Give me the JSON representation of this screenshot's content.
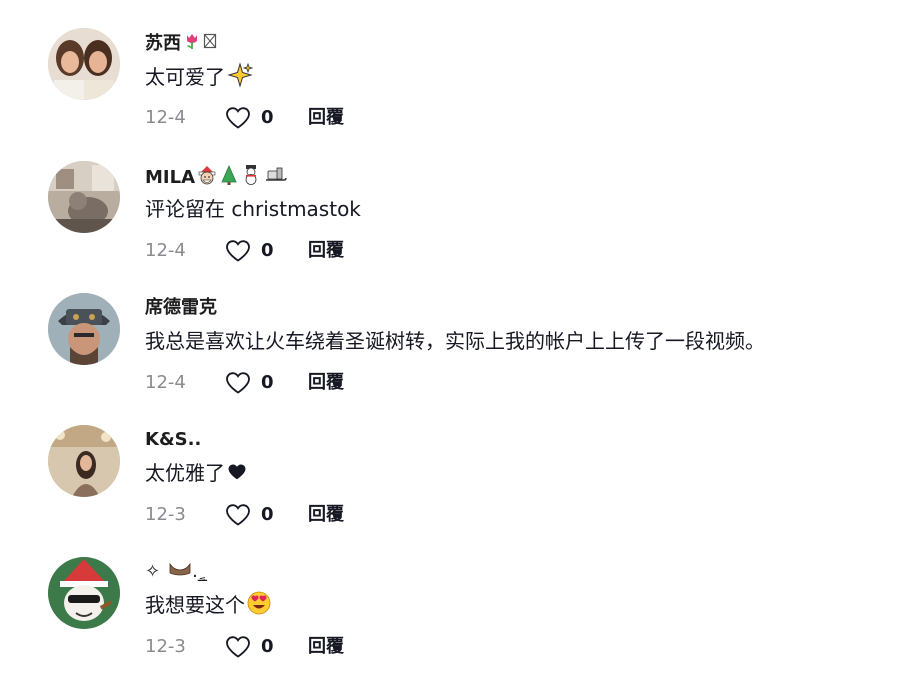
{
  "comments": [
    {
      "username": "苏西",
      "username_emojis": [
        "tulip-emoji",
        "box-glyph"
      ],
      "text": "太可爱了",
      "text_emoji": "sparkles-emoji",
      "date": "12-4",
      "likes": "0",
      "reply_label": "回覆"
    },
    {
      "username": "MILA",
      "username_emojis": [
        "santa-emoji",
        "christmas-tree-emoji",
        "snowman-emoji",
        "sleigh-emoji"
      ],
      "text": "评论留在 christmastok",
      "text_emoji": "",
      "date": "12-4",
      "likes": "0",
      "reply_label": "回覆"
    },
    {
      "username": "席德雷克",
      "username_emojis": [],
      "text": "我总是喜欢让火车绕着圣诞树转，实际上我的帐户上上传了一段视频。",
      "text_emoji": "",
      "date": "12-4",
      "likes": "0",
      "reply_label": "回覆"
    },
    {
      "username": "K&S..",
      "username_emojis": [],
      "text": "太优雅了",
      "text_emoji": "black-heart-emoji",
      "date": "12-3",
      "likes": "0",
      "reply_label": "回覆"
    },
    {
      "username": "✧",
      "username_emojis": [
        "boot-emoji"
      ],
      "username_suffix": "._ٍ",
      "text": "我想要这个",
      "text_emoji": "heart-eyes-emoji",
      "date": "12-3",
      "likes": "0",
      "reply_label": "回覆"
    }
  ],
  "colors": {
    "text": "#161823",
    "meta": "#8a8b91",
    "background": "#ffffff"
  }
}
